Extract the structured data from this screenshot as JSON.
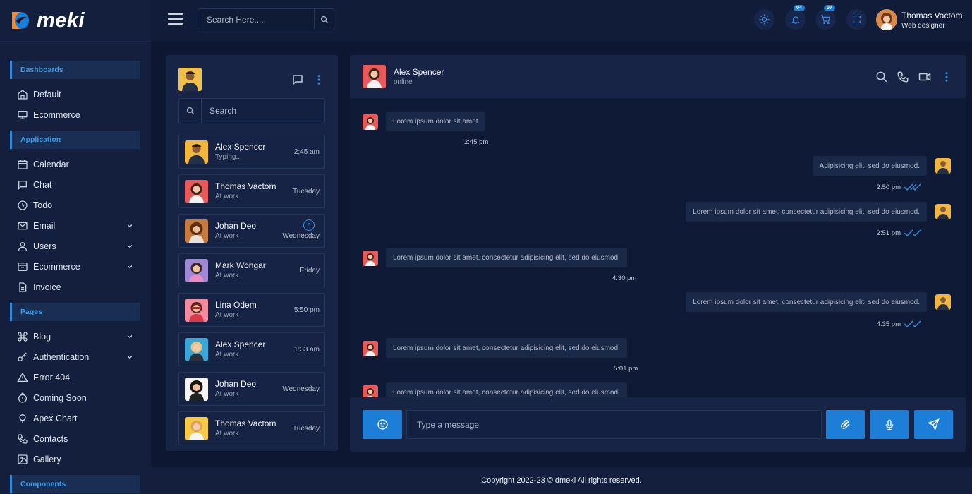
{
  "brand": {
    "name": "meki"
  },
  "header": {
    "search_placeholder": "Search Here.....",
    "notifications_count": "04",
    "cart_count": "07",
    "user_name": "Thomas Vactom",
    "user_role": "Web designer"
  },
  "sidebar": {
    "sections": [
      "Dashboards",
      "Application",
      "Pages",
      "Components"
    ],
    "items": [
      {
        "label": "Default",
        "icon": "home-icon"
      },
      {
        "label": "Ecommerce",
        "icon": "monitor-icon"
      },
      {
        "label": "Calendar",
        "icon": "calendar-icon"
      },
      {
        "label": "Chat",
        "icon": "chat-icon"
      },
      {
        "label": "Todo",
        "icon": "clock-icon"
      },
      {
        "label": "Email",
        "icon": "mail-icon"
      },
      {
        "label": "Users",
        "icon": "user-icon"
      },
      {
        "label": "Ecommerce",
        "icon": "box-icon"
      },
      {
        "label": "Invoice",
        "icon": "file-icon"
      },
      {
        "label": "Blog",
        "icon": "command-icon"
      },
      {
        "label": "Authentication",
        "icon": "key-icon"
      },
      {
        "label": "Error 404",
        "icon": "warning-icon"
      },
      {
        "label": "Coming Soon",
        "icon": "timer-icon"
      },
      {
        "label": "Apex Chart",
        "icon": "pin-icon"
      },
      {
        "label": "Contacts",
        "icon": "phone-icon"
      },
      {
        "label": "Gallery",
        "icon": "image-icon"
      }
    ]
  },
  "contacts": {
    "search_placeholder": "Search",
    "list": [
      {
        "name": "Alex Spencer",
        "status": "Typing..",
        "time": "2:45 am"
      },
      {
        "name": "Thomas Vactom",
        "status": "At work",
        "time": "Tuesday"
      },
      {
        "name": "Johan Deo",
        "status": "At work",
        "time": "Wednesday",
        "unread": "5"
      },
      {
        "name": "Mark Wongar",
        "status": "At work",
        "time": "Friday"
      },
      {
        "name": "Lina Odem",
        "status": "At work",
        "time": "5:50 pm"
      },
      {
        "name": "Alex Spencer",
        "status": "At work",
        "time": "1:33 am"
      },
      {
        "name": "Johan Deo",
        "status": "At work",
        "time": "Wednesday"
      },
      {
        "name": "Thomas Vactom",
        "status": "At work",
        "time": "Tuesday"
      }
    ]
  },
  "chat": {
    "contact_name": "Alex Spencer",
    "contact_status": "online",
    "messages": [
      {
        "side": "left",
        "text": "Lorem ipsum dolor sit amet",
        "time": "2:45 pm"
      },
      {
        "side": "right",
        "text": "Adipisicing elit, sed do eiusmod.",
        "time": "2:50 pm"
      },
      {
        "side": "right",
        "text": "Lorem ipsum dolor sit amet, consectetur adipisicing elit, sed do eiusmod.",
        "time": "2:51 pm"
      },
      {
        "side": "left",
        "text": "Lorem ipsum dolor sit amet, consectetur adipisicing elit, sed do eiusmod.",
        "time": "4:30 pm"
      },
      {
        "side": "right",
        "text": "Lorem ipsum dolor sit amet, consectetur adipisicing elit, sed do eiusmod.",
        "time": "4:35 pm"
      },
      {
        "side": "left",
        "text": "Lorem ipsum dolor sit amet, consectetur adipisicing elit, sed do eiusmod.",
        "time": "5:01 pm"
      },
      {
        "side": "left",
        "text": "Lorem ipsum dolor sit amet, consectetur adipisicing elit, sed do eiusmod.",
        "time": ""
      }
    ],
    "input_placeholder": "Type a message"
  },
  "footer": {
    "copyright": "Copyright 2022-23 © dmeki All rights reserved."
  },
  "colors": {
    "accent": "#1c7ed6",
    "background": "#0d1731",
    "panel": "#172445"
  }
}
